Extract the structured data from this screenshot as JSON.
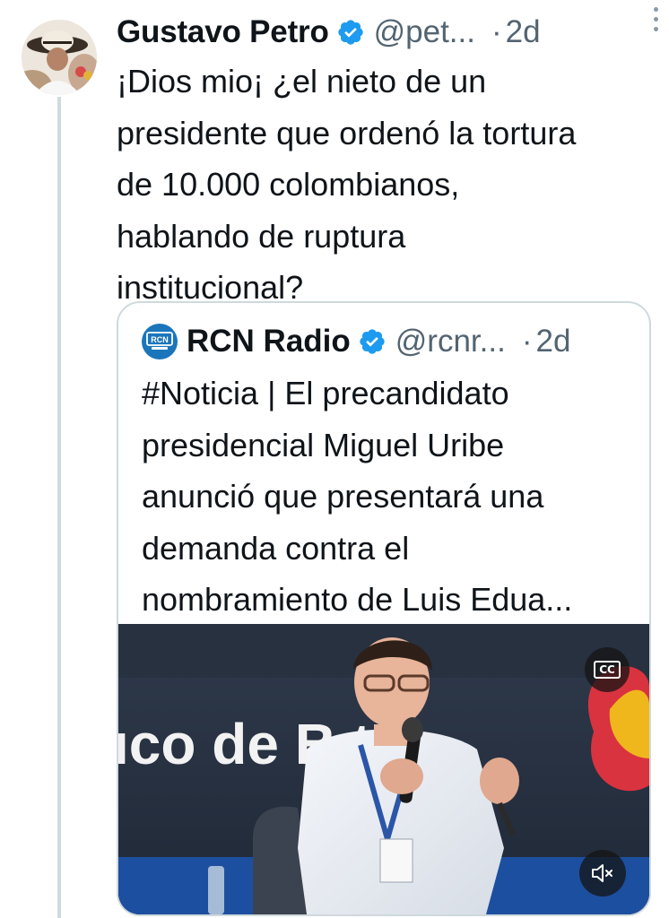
{
  "tweet": {
    "author_name": "Gustavo Petro",
    "author_handle": "@pet...",
    "time_sep": "·",
    "time": "2d",
    "text_lines": [
      "¡Dios mio¡ ¿el nieto de un",
      "presidente que ordenó la tortura",
      "de 10.000 colombianos,",
      "hablando de ruptura",
      "institucional?"
    ]
  },
  "quote": {
    "author_name": "RCN Radio",
    "author_handle": "@rcnr...",
    "time_sep": "·",
    "time": "2d",
    "logo_text": "RCN",
    "text_lines": [
      "#Noticia | El precandidato",
      "presidencial Miguel Uribe",
      "anunció que presentará una",
      "demanda contra el",
      "nombramiento de Luis Edua..."
    ],
    "video": {
      "backdrop_text": "ıco de B   tá",
      "cc_label": "CC"
    }
  },
  "colors": {
    "verified_blue": "#1d9bf0",
    "secondary_text": "#536471",
    "thread_line": "#cfd9de",
    "rcn_blue": "#1b75bb"
  },
  "icons": [
    "verified-badge-icon",
    "more-options-icon",
    "closed-captions-icon",
    "muted-volume-icon"
  ]
}
